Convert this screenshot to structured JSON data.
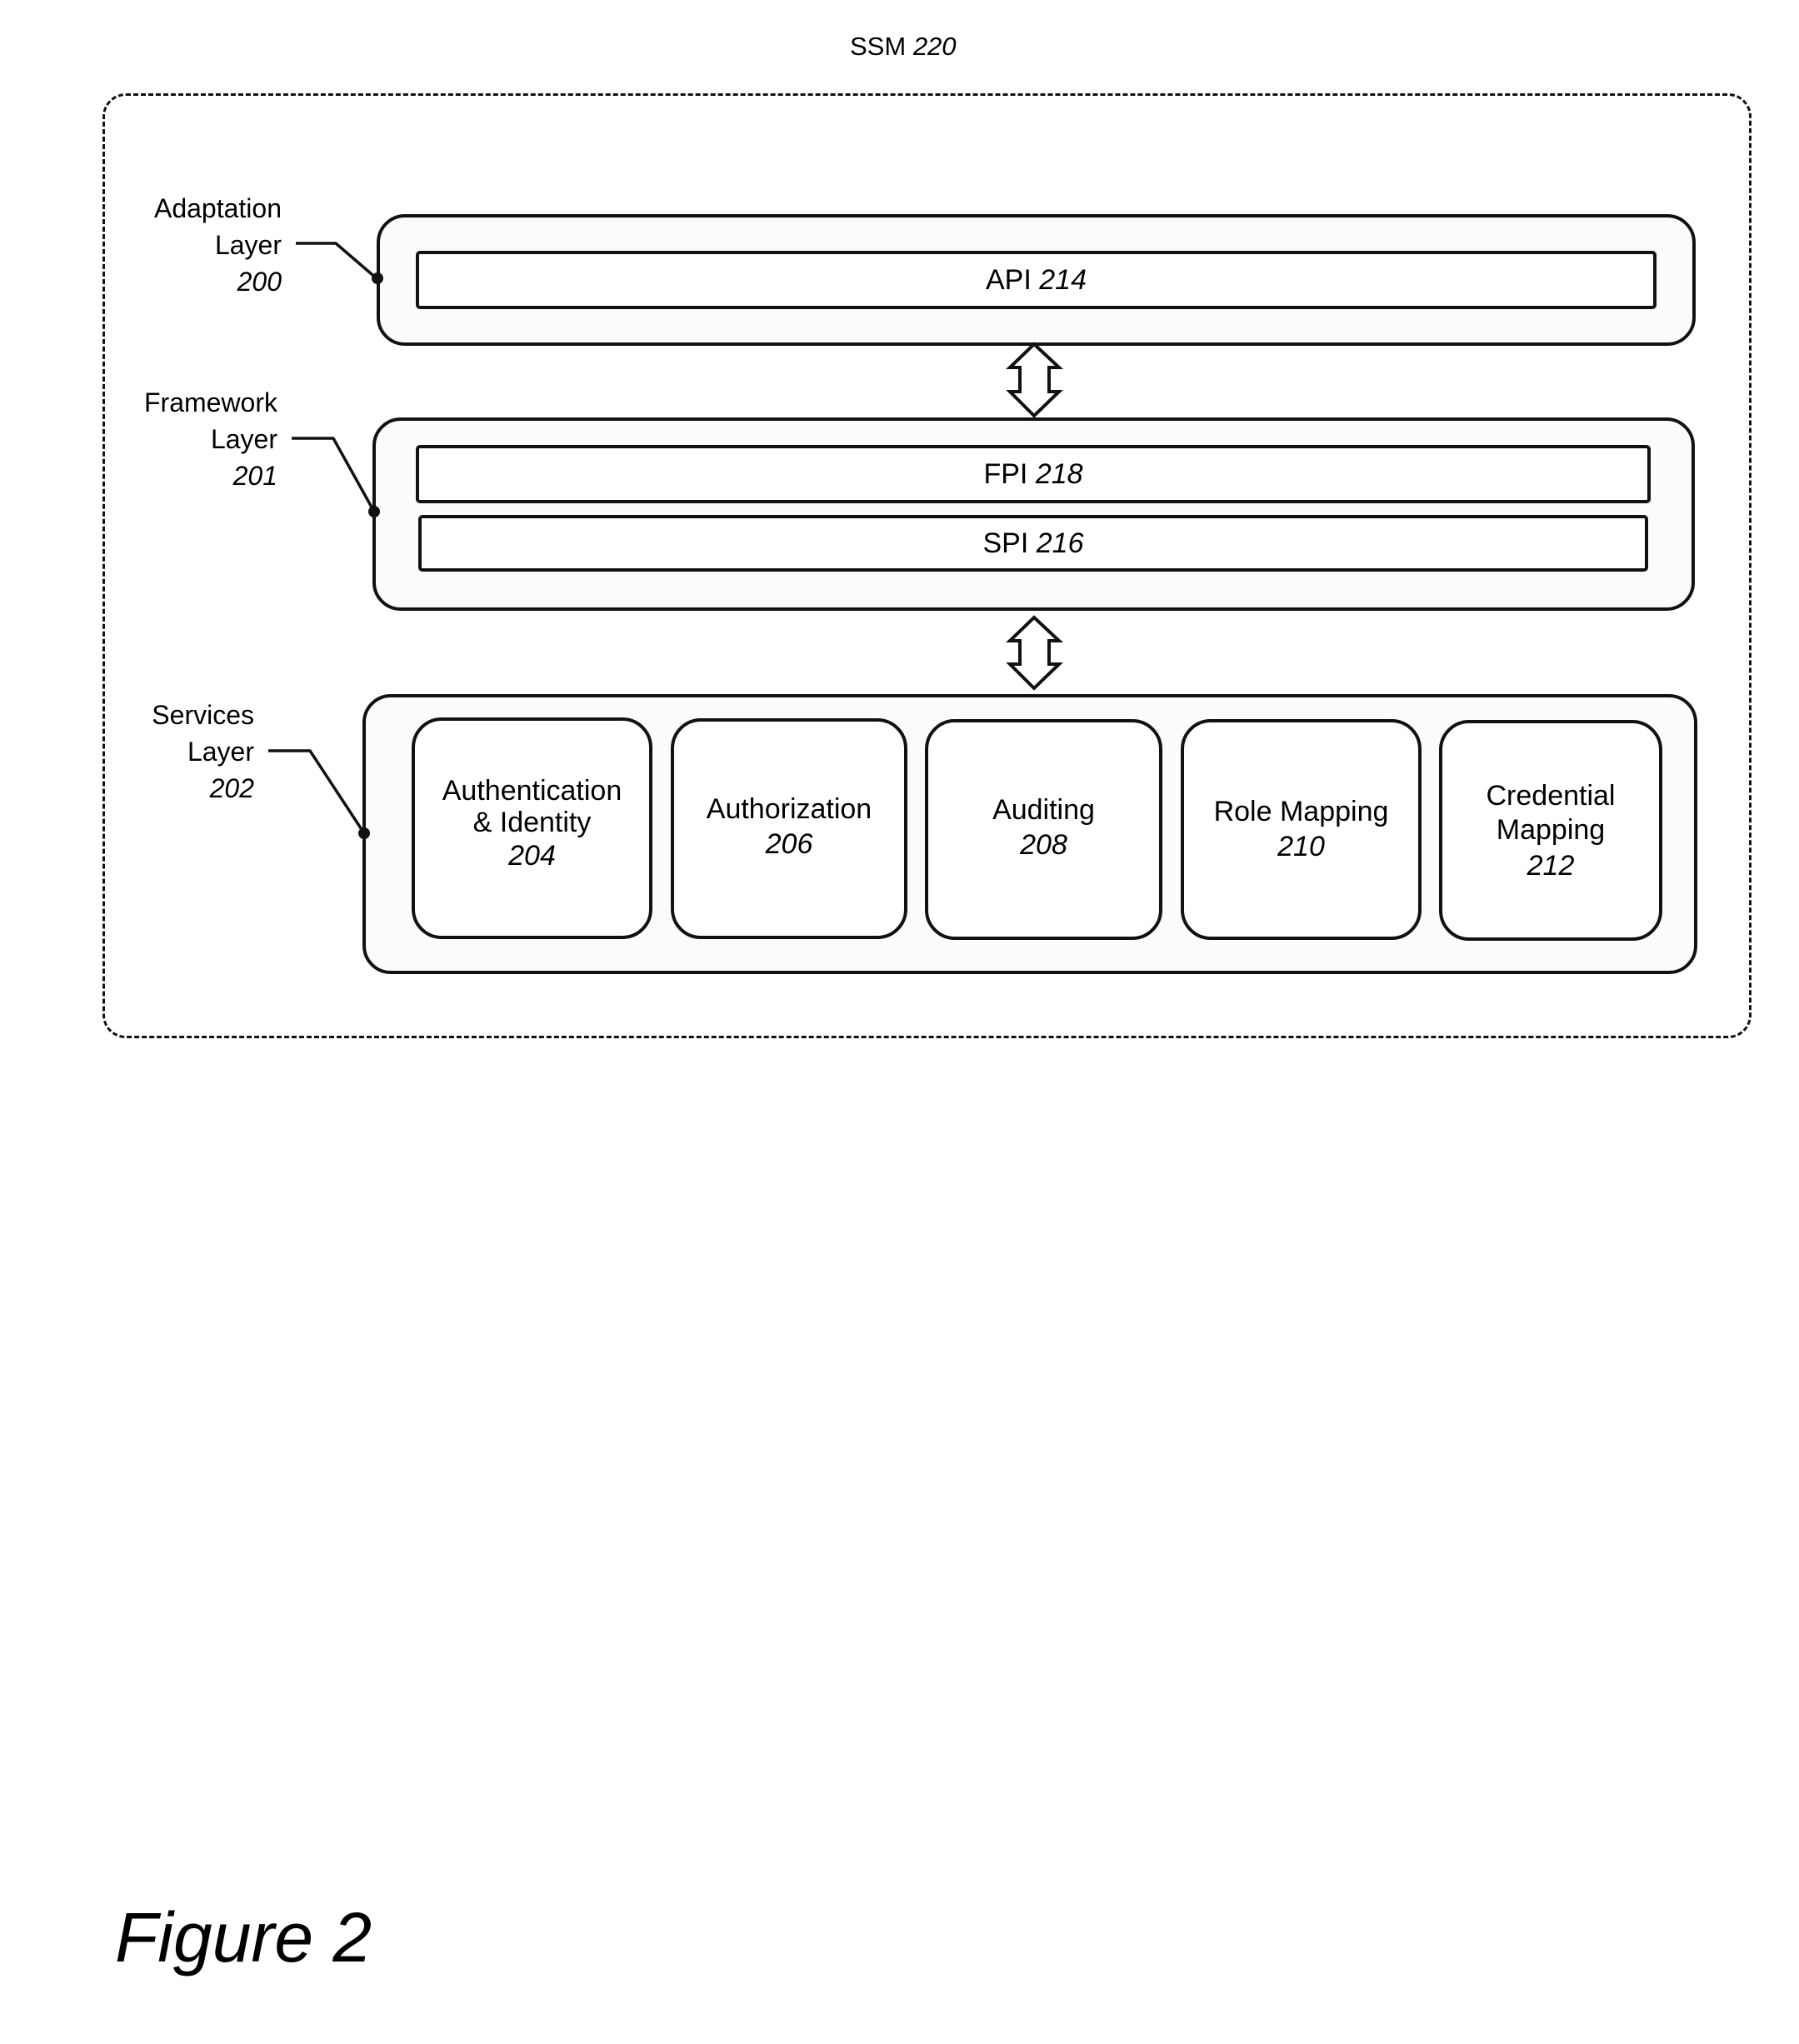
{
  "title": {
    "name": "SSM",
    "ref": "220"
  },
  "layers": [
    {
      "id": "adaptation",
      "label_line1": "Adaptation",
      "label_line2": "Layer",
      "ref": "200",
      "components": [
        {
          "name": "API",
          "ref": "214"
        }
      ]
    },
    {
      "id": "framework",
      "label_line1": "Framework",
      "label_line2": "Layer",
      "ref": "201",
      "components": [
        {
          "name": "FPI",
          "ref": "218"
        },
        {
          "name": "SPI",
          "ref": "216"
        }
      ]
    },
    {
      "id": "services",
      "label_line1": "Services",
      "label_line2": "Layer",
      "ref": "202",
      "components": [
        {
          "line1": "Authentication",
          "line2": "& Identity",
          "ref": "204"
        },
        {
          "line1": "Authorization",
          "line2": "",
          "ref": "206"
        },
        {
          "line1": "Auditing",
          "line2": "",
          "ref": "208"
        },
        {
          "line1": "Role Mapping",
          "line2": "",
          "ref": "210"
        },
        {
          "line1": "Credential",
          "line2": "Mapping",
          "ref": "212"
        }
      ]
    }
  ],
  "connections": [
    {
      "from": "adaptation",
      "to": "framework",
      "type": "bidirectional-arrow"
    },
    {
      "from": "framework",
      "to": "services",
      "type": "bidirectional-arrow"
    }
  ],
  "caption": "Figure 2"
}
